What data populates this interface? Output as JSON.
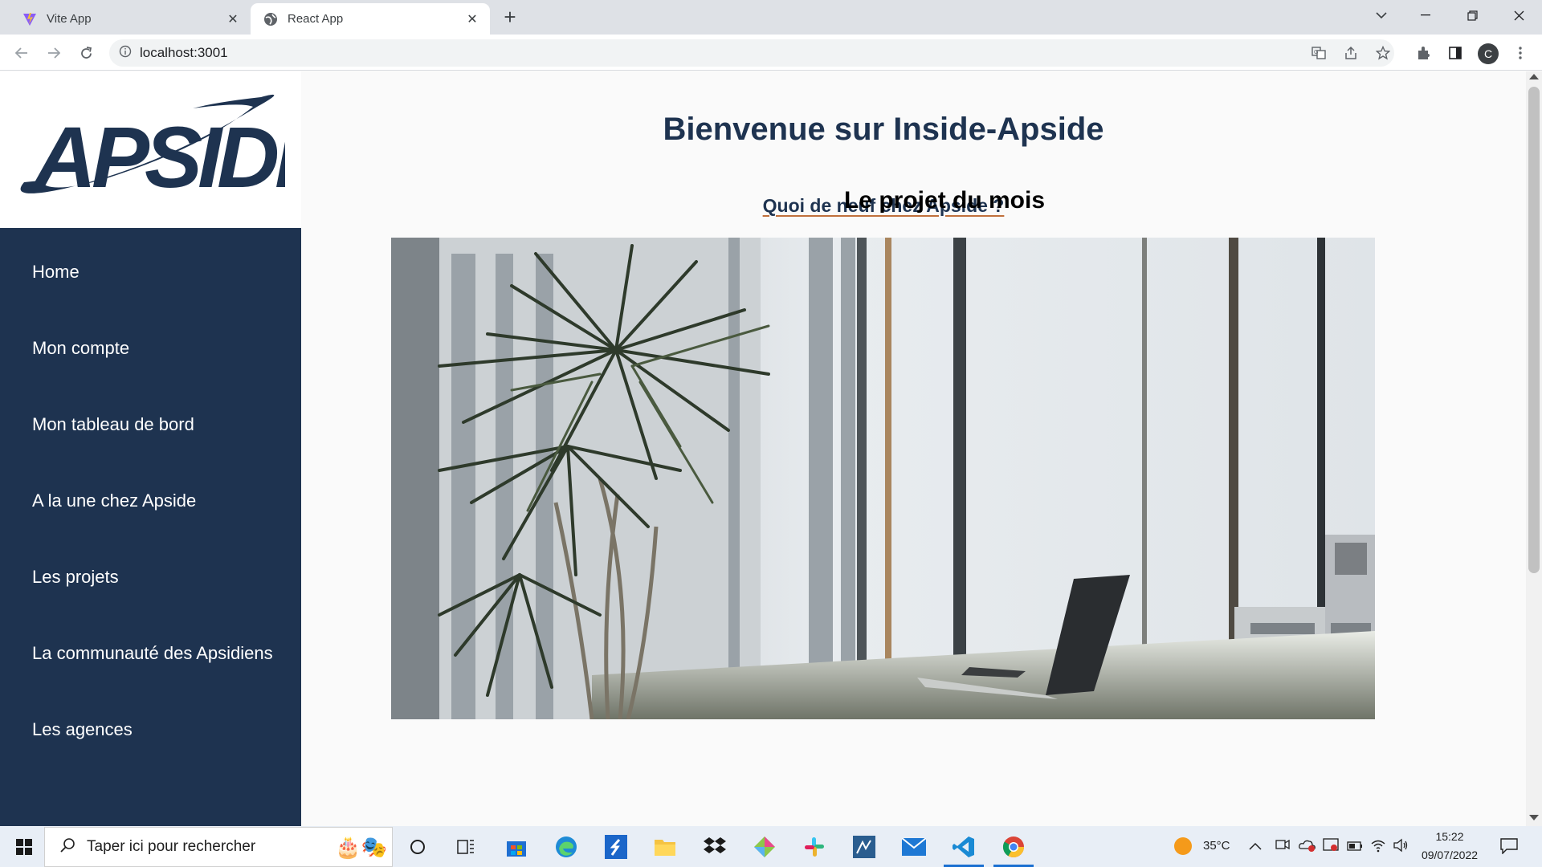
{
  "browser": {
    "tabs": [
      {
        "title": "Vite App",
        "active": false,
        "icon": "vite-icon"
      },
      {
        "title": "React App",
        "active": true,
        "icon": "globe-icon"
      }
    ],
    "url": "localhost:3001",
    "profile_initial": "C"
  },
  "page": {
    "logo_text": "APSIDE",
    "title": "Bienvenue sur Inside-Apside",
    "news_link": "Quoi de neuf chez Apside ?",
    "hero_caption": "Le projet du mois",
    "nav": [
      {
        "label": "Home"
      },
      {
        "label": "Mon compte"
      },
      {
        "label": "Mon tableau de bord"
      },
      {
        "label": "A la une chez Apside"
      },
      {
        "label": "Les projets"
      },
      {
        "label": "La communauté des Apsidiens"
      },
      {
        "label": "Les agences"
      }
    ],
    "colors": {
      "navy": "#1e3350",
      "accent": "#c0703c"
    }
  },
  "taskbar": {
    "search_placeholder": "Taper ici pour rechercher",
    "weather": "35°C",
    "time": "15:22",
    "date": "09/07/2022"
  }
}
